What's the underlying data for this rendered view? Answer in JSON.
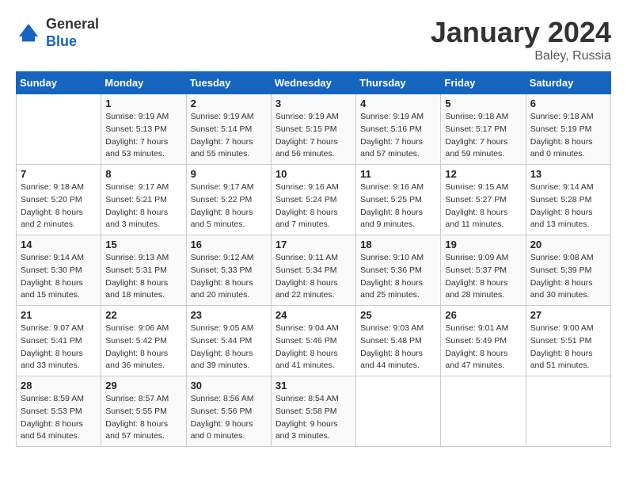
{
  "header": {
    "logo_line1": "General",
    "logo_line2": "Blue",
    "month": "January 2024",
    "location": "Baley, Russia"
  },
  "weekdays": [
    "Sunday",
    "Monday",
    "Tuesday",
    "Wednesday",
    "Thursday",
    "Friday",
    "Saturday"
  ],
  "weeks": [
    [
      {
        "day": "",
        "sunrise": "",
        "sunset": "",
        "daylight": ""
      },
      {
        "day": "1",
        "sunrise": "Sunrise: 9:19 AM",
        "sunset": "Sunset: 5:13 PM",
        "daylight": "Daylight: 7 hours and 53 minutes."
      },
      {
        "day": "2",
        "sunrise": "Sunrise: 9:19 AM",
        "sunset": "Sunset: 5:14 PM",
        "daylight": "Daylight: 7 hours and 55 minutes."
      },
      {
        "day": "3",
        "sunrise": "Sunrise: 9:19 AM",
        "sunset": "Sunset: 5:15 PM",
        "daylight": "Daylight: 7 hours and 56 minutes."
      },
      {
        "day": "4",
        "sunrise": "Sunrise: 9:19 AM",
        "sunset": "Sunset: 5:16 PM",
        "daylight": "Daylight: 7 hours and 57 minutes."
      },
      {
        "day": "5",
        "sunrise": "Sunrise: 9:18 AM",
        "sunset": "Sunset: 5:17 PM",
        "daylight": "Daylight: 7 hours and 59 minutes."
      },
      {
        "day": "6",
        "sunrise": "Sunrise: 9:18 AM",
        "sunset": "Sunset: 5:19 PM",
        "daylight": "Daylight: 8 hours and 0 minutes."
      }
    ],
    [
      {
        "day": "7",
        "sunrise": "Sunrise: 9:18 AM",
        "sunset": "Sunset: 5:20 PM",
        "daylight": "Daylight: 8 hours and 2 minutes."
      },
      {
        "day": "8",
        "sunrise": "Sunrise: 9:17 AM",
        "sunset": "Sunset: 5:21 PM",
        "daylight": "Daylight: 8 hours and 3 minutes."
      },
      {
        "day": "9",
        "sunrise": "Sunrise: 9:17 AM",
        "sunset": "Sunset: 5:22 PM",
        "daylight": "Daylight: 8 hours and 5 minutes."
      },
      {
        "day": "10",
        "sunrise": "Sunrise: 9:16 AM",
        "sunset": "Sunset: 5:24 PM",
        "daylight": "Daylight: 8 hours and 7 minutes."
      },
      {
        "day": "11",
        "sunrise": "Sunrise: 9:16 AM",
        "sunset": "Sunset: 5:25 PM",
        "daylight": "Daylight: 8 hours and 9 minutes."
      },
      {
        "day": "12",
        "sunrise": "Sunrise: 9:15 AM",
        "sunset": "Sunset: 5:27 PM",
        "daylight": "Daylight: 8 hours and 11 minutes."
      },
      {
        "day": "13",
        "sunrise": "Sunrise: 9:14 AM",
        "sunset": "Sunset: 5:28 PM",
        "daylight": "Daylight: 8 hours and 13 minutes."
      }
    ],
    [
      {
        "day": "14",
        "sunrise": "Sunrise: 9:14 AM",
        "sunset": "Sunset: 5:30 PM",
        "daylight": "Daylight: 8 hours and 15 minutes."
      },
      {
        "day": "15",
        "sunrise": "Sunrise: 9:13 AM",
        "sunset": "Sunset: 5:31 PM",
        "daylight": "Daylight: 8 hours and 18 minutes."
      },
      {
        "day": "16",
        "sunrise": "Sunrise: 9:12 AM",
        "sunset": "Sunset: 5:33 PM",
        "daylight": "Daylight: 8 hours and 20 minutes."
      },
      {
        "day": "17",
        "sunrise": "Sunrise: 9:11 AM",
        "sunset": "Sunset: 5:34 PM",
        "daylight": "Daylight: 8 hours and 22 minutes."
      },
      {
        "day": "18",
        "sunrise": "Sunrise: 9:10 AM",
        "sunset": "Sunset: 5:36 PM",
        "daylight": "Daylight: 8 hours and 25 minutes."
      },
      {
        "day": "19",
        "sunrise": "Sunrise: 9:09 AM",
        "sunset": "Sunset: 5:37 PM",
        "daylight": "Daylight: 8 hours and 28 minutes."
      },
      {
        "day": "20",
        "sunrise": "Sunrise: 9:08 AM",
        "sunset": "Sunset: 5:39 PM",
        "daylight": "Daylight: 8 hours and 30 minutes."
      }
    ],
    [
      {
        "day": "21",
        "sunrise": "Sunrise: 9:07 AM",
        "sunset": "Sunset: 5:41 PM",
        "daylight": "Daylight: 8 hours and 33 minutes."
      },
      {
        "day": "22",
        "sunrise": "Sunrise: 9:06 AM",
        "sunset": "Sunset: 5:42 PM",
        "daylight": "Daylight: 8 hours and 36 minutes."
      },
      {
        "day": "23",
        "sunrise": "Sunrise: 9:05 AM",
        "sunset": "Sunset: 5:44 PM",
        "daylight": "Daylight: 8 hours and 39 minutes."
      },
      {
        "day": "24",
        "sunrise": "Sunrise: 9:04 AM",
        "sunset": "Sunset: 5:46 PM",
        "daylight": "Daylight: 8 hours and 41 minutes."
      },
      {
        "day": "25",
        "sunrise": "Sunrise: 9:03 AM",
        "sunset": "Sunset: 5:48 PM",
        "daylight": "Daylight: 8 hours and 44 minutes."
      },
      {
        "day": "26",
        "sunrise": "Sunrise: 9:01 AM",
        "sunset": "Sunset: 5:49 PM",
        "daylight": "Daylight: 8 hours and 47 minutes."
      },
      {
        "day": "27",
        "sunrise": "Sunrise: 9:00 AM",
        "sunset": "Sunset: 5:51 PM",
        "daylight": "Daylight: 8 hours and 51 minutes."
      }
    ],
    [
      {
        "day": "28",
        "sunrise": "Sunrise: 8:59 AM",
        "sunset": "Sunset: 5:53 PM",
        "daylight": "Daylight: 8 hours and 54 minutes."
      },
      {
        "day": "29",
        "sunrise": "Sunrise: 8:57 AM",
        "sunset": "Sunset: 5:55 PM",
        "daylight": "Daylight: 8 hours and 57 minutes."
      },
      {
        "day": "30",
        "sunrise": "Sunrise: 8:56 AM",
        "sunset": "Sunset: 5:56 PM",
        "daylight": "Daylight: 9 hours and 0 minutes."
      },
      {
        "day": "31",
        "sunrise": "Sunrise: 8:54 AM",
        "sunset": "Sunset: 5:58 PM",
        "daylight": "Daylight: 9 hours and 3 minutes."
      },
      {
        "day": "",
        "sunrise": "",
        "sunset": "",
        "daylight": ""
      },
      {
        "day": "",
        "sunrise": "",
        "sunset": "",
        "daylight": ""
      },
      {
        "day": "",
        "sunrise": "",
        "sunset": "",
        "daylight": ""
      }
    ]
  ]
}
